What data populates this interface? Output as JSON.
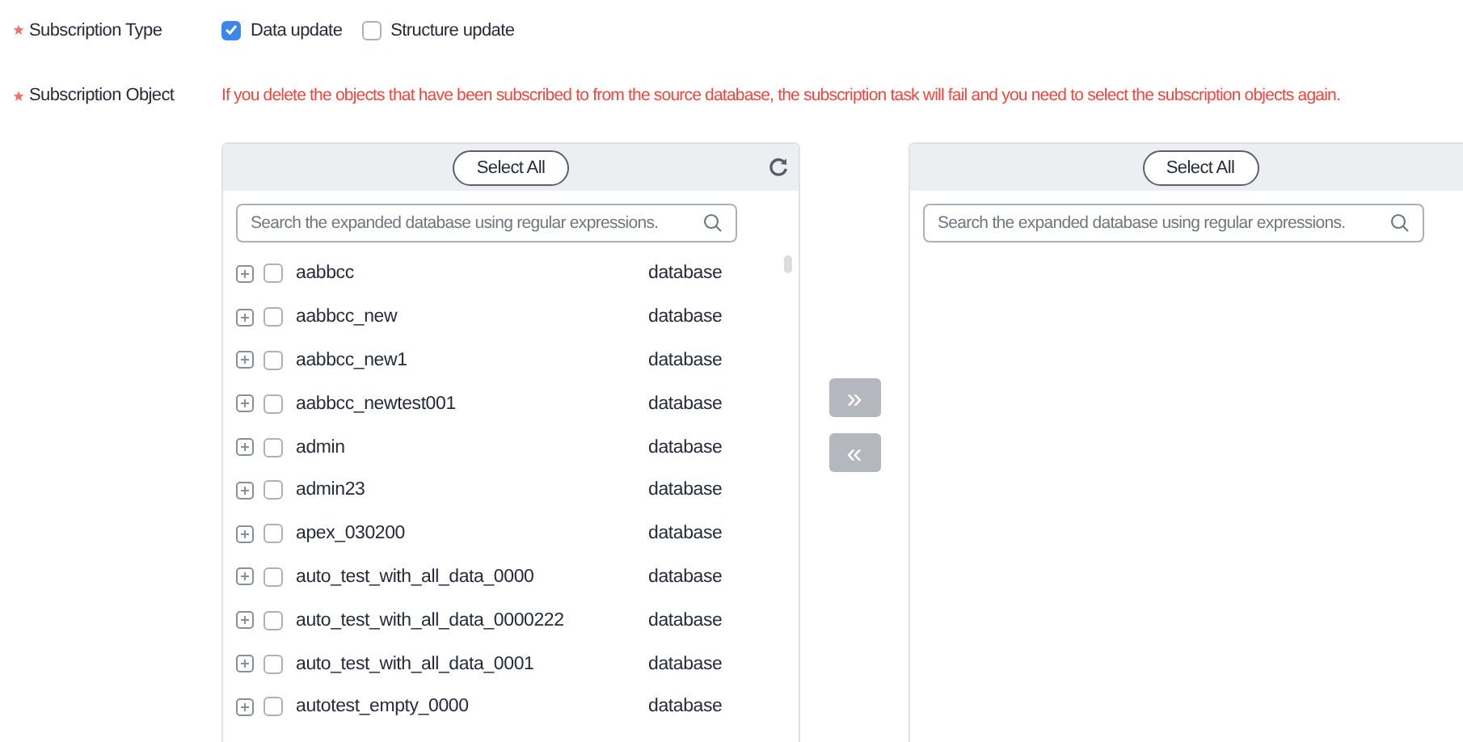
{
  "form": {
    "subscription_type": {
      "label": "Subscription Type",
      "required": true,
      "options": [
        {
          "label": "Data update",
          "checked": true
        },
        {
          "label": "Structure update",
          "checked": false
        }
      ]
    },
    "subscription_object": {
      "label": "Subscription Object",
      "required": true,
      "warning": "If you delete the objects that have been subscribed to from the source database, the subscription task will fail and you need to select the subscription objects again."
    }
  },
  "source_panel": {
    "select_all": "Select All",
    "search": {
      "placeholder": "Search the expanded database using regular expressions."
    },
    "items": [
      {
        "name": "aabbcc",
        "type": "database",
        "checked": false
      },
      {
        "name": "aabbcc_new",
        "type": "database",
        "checked": false
      },
      {
        "name": "aabbcc_new1",
        "type": "database",
        "checked": false
      },
      {
        "name": "aabbcc_newtest001",
        "type": "database",
        "checked": false
      },
      {
        "name": "admin",
        "type": "database",
        "checked": false
      },
      {
        "name": "admin23",
        "type": "database",
        "checked": false
      },
      {
        "name": "apex_030200",
        "type": "database",
        "checked": false
      },
      {
        "name": "auto_test_with_all_data_0000",
        "type": "database",
        "checked": false
      },
      {
        "name": "auto_test_with_all_data_0000222",
        "type": "database",
        "checked": false
      },
      {
        "name": "auto_test_with_all_data_0001",
        "type": "database",
        "checked": false
      },
      {
        "name": "autotest_empty_0000",
        "type": "database",
        "checked": false
      }
    ]
  },
  "transfer_buttons": [
    {
      "label": "»",
      "disabled": true
    },
    {
      "label": "«",
      "disabled": true
    }
  ],
  "target_panel": {
    "select_all": "Select All",
    "search": {
      "placeholder": "Search the expanded database using regular expressions."
    }
  }
}
